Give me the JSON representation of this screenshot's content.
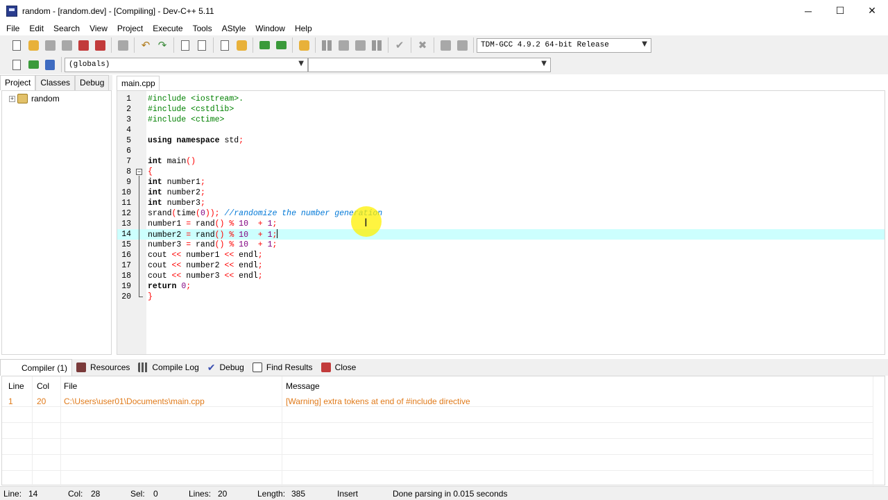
{
  "window": {
    "title": "random - [random.dev] - [Compiling] - Dev-C++ 5.11",
    "minimize": "─",
    "maximize": "☐",
    "close": "✕"
  },
  "menu": [
    "File",
    "Edit",
    "Search",
    "View",
    "Project",
    "Execute",
    "Tools",
    "AStyle",
    "Window",
    "Help"
  ],
  "toolbar": {
    "compiler_select": "TDM-GCC 4.9.2 64-bit Release",
    "scope_select": "(globals)",
    "member_select": ""
  },
  "left_panel": {
    "tabs": [
      "Project",
      "Classes",
      "Debug"
    ],
    "active_tab": "Project",
    "tree_root": "random",
    "tree_expander": "+"
  },
  "editor": {
    "file_tab": "main.cpp",
    "current_line": 14,
    "line_numbers": [
      "1",
      "2",
      "3",
      "4",
      "5",
      "6",
      "7",
      "8",
      "9",
      "10",
      "11",
      "12",
      "13",
      "14",
      "15",
      "16",
      "17",
      "18",
      "19",
      "20"
    ],
    "fold_marker": "−"
  },
  "bottom_panel": {
    "tabs": [
      "Compiler (1)",
      "Resources",
      "Compile Log",
      "Debug",
      "Find Results",
      "Close"
    ],
    "active_tab": "Compiler (1)",
    "columns": [
      "Line",
      "Col",
      "File",
      "Message"
    ],
    "rows": [
      {
        "line": "1",
        "col": "20",
        "file": "C:\\Users\\user01\\Documents\\main.cpp",
        "message": "[Warning] extra tokens at end of #include directive"
      }
    ]
  },
  "status": {
    "line_label": "Line:",
    "line_value": "14",
    "col_label": "Col:",
    "col_value": "28",
    "sel_label": "Sel:",
    "sel_value": "0",
    "lines_label": "Lines:",
    "lines_value": "20",
    "length_label": "Length:",
    "length_value": "385",
    "mode": "Insert",
    "message": "Done parsing in 0.015 seconds"
  },
  "colors": {
    "current_line": "#ccfffe",
    "preprocessor": "#008000",
    "symbol": "#ff0000",
    "number": "#800080",
    "comment": "#0078d7",
    "warning_text": "#e07a1a"
  }
}
